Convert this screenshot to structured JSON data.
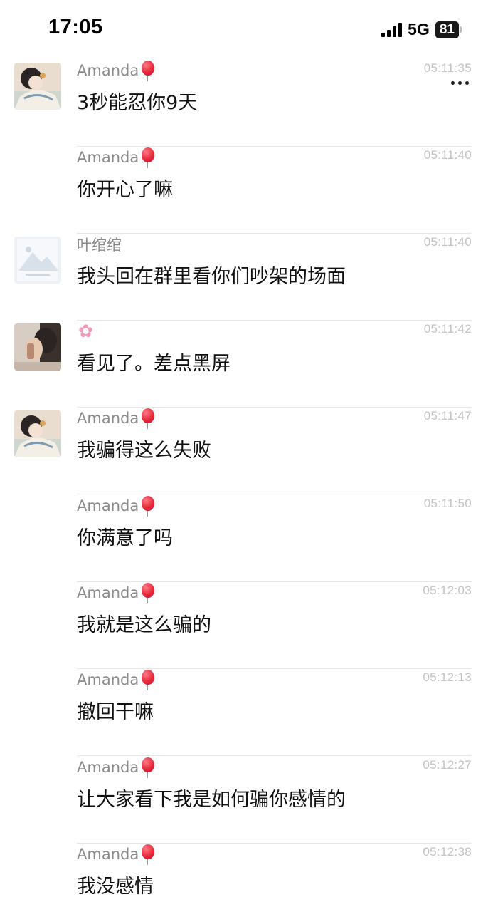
{
  "status_bar": {
    "time": "17:05",
    "network": "5G",
    "battery": "81"
  },
  "messages": [
    {
      "sender": "Amanda",
      "badge": "balloon-icon",
      "time": "05:11:35",
      "text": "3秒能忍你9天",
      "avatar": "avatar-amanda"
    },
    {
      "sender": "Amanda",
      "badge": "balloon-icon",
      "time": "05:11:40",
      "text": "你开心了嘛",
      "avatar": ""
    },
    {
      "sender": "叶绾绾",
      "badge": "",
      "time": "05:11:40",
      "text": "我头回在群里看你们吵架的场面",
      "avatar": "avatar-landscape"
    },
    {
      "sender": "",
      "badge": "flower-icon",
      "time": "05:11:42",
      "text": "看见了。差点黑屏",
      "avatar": "avatar-photo"
    },
    {
      "sender": "Amanda",
      "badge": "balloon-icon",
      "time": "05:11:47",
      "text": "我骗得这么失败",
      "avatar": "avatar-amanda"
    },
    {
      "sender": "Amanda",
      "badge": "balloon-icon",
      "time": "05:11:50",
      "text": "你满意了吗",
      "avatar": ""
    },
    {
      "sender": "Amanda",
      "badge": "balloon-icon",
      "time": "05:12:03",
      "text": "我就是这么骗的",
      "avatar": ""
    },
    {
      "sender": "Amanda",
      "badge": "balloon-icon",
      "time": "05:12:13",
      "text": "撤回干嘛",
      "avatar": ""
    },
    {
      "sender": "Amanda",
      "badge": "balloon-icon",
      "time": "05:12:27",
      "text": "让大家看下我是如何骗你感情的",
      "avatar": ""
    },
    {
      "sender": "Amanda",
      "badge": "balloon-icon",
      "time": "05:12:38",
      "text": "我没感情",
      "avatar": ""
    }
  ]
}
